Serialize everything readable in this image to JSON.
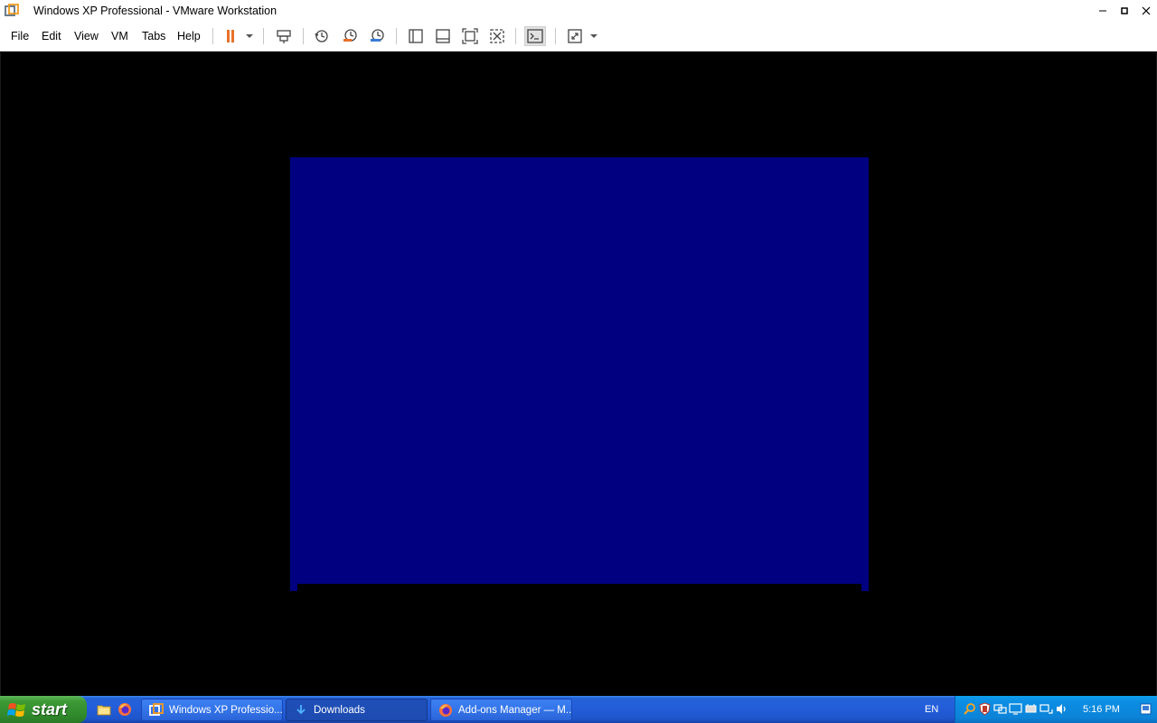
{
  "window": {
    "title": "Windows XP Professional - VMware Workstation"
  },
  "menu": {
    "items": [
      "File",
      "Edit",
      "View",
      "VM",
      "Tabs",
      "Help"
    ]
  },
  "vm": {
    "screen_color": "#000080",
    "background_color": "#000000"
  },
  "taskbar": {
    "start_label": "start",
    "tasks": [
      {
        "label": "Windows XP Professio...",
        "icon": "vmware-icon",
        "active": false
      },
      {
        "label": "Downloads",
        "icon": "download-icon",
        "active": true
      },
      {
        "label": "Add-ons Manager — M...",
        "icon": "firefox-icon",
        "active": false
      }
    ],
    "language": "EN",
    "clock": "5:16 PM"
  },
  "colors": {
    "accent_orange": "#e8712a",
    "taskbar_blue": "#245edb",
    "start_green": "#3c9a35",
    "tray_blue": "#0c8ee3"
  }
}
